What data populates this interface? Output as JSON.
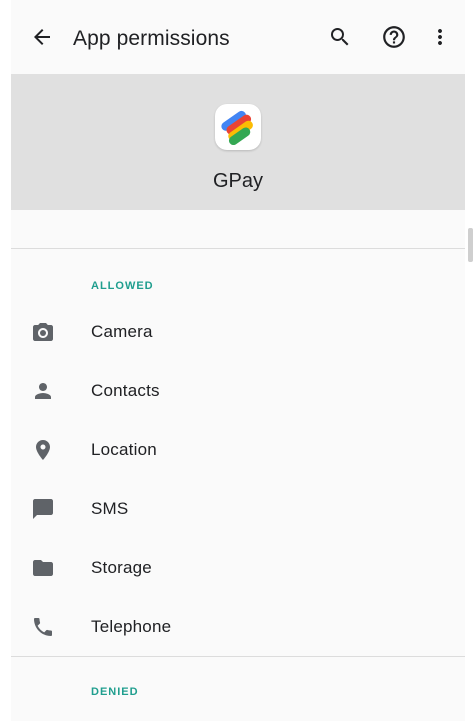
{
  "toolbar": {
    "title": "App permissions",
    "back_icon": "arrow-left-icon",
    "search_icon": "search-icon",
    "help_icon": "help-circle-icon",
    "more_icon": "more-vert-icon"
  },
  "app": {
    "name": "GPay",
    "icon": "gpay-logo-icon"
  },
  "sections": {
    "allowed": {
      "header": "ALLOWED",
      "items": [
        {
          "label": "Camera",
          "icon": "camera-icon"
        },
        {
          "label": "Contacts",
          "icon": "person-icon"
        },
        {
          "label": "Location",
          "icon": "location-pin-icon"
        },
        {
          "label": "SMS",
          "icon": "message-icon"
        },
        {
          "label": "Storage",
          "icon": "folder-icon"
        },
        {
          "label": "Telephone",
          "icon": "phone-icon"
        }
      ]
    },
    "denied": {
      "header": "DENIED"
    }
  },
  "colors": {
    "accent": "#1f9e8e",
    "header_bg": "#e0e0e0",
    "icon_gray": "#5f6368"
  }
}
